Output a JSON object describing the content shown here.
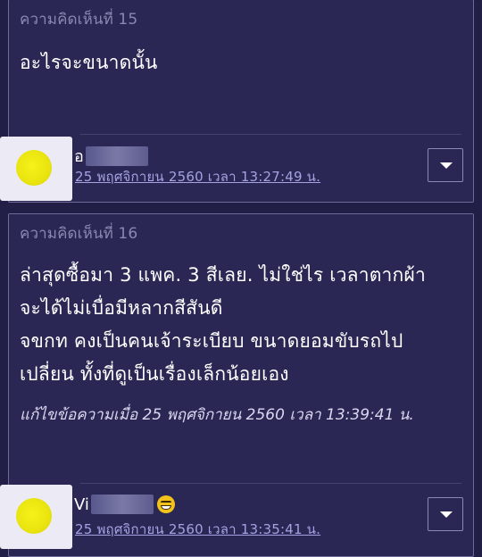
{
  "comments": [
    {
      "header": "ความคิดเห็นที่ 15",
      "body_lines": [
        "อะไรจะขนาดนั้น"
      ],
      "edited_note": "",
      "username_visible": "อ",
      "timestamp": "25 พฤศจิกายน 2560 เวลา 13:27:49 น.",
      "has_emoji": false
    },
    {
      "header": "ความคิดเห็นที่ 16",
      "body_lines": [
        "ล่าสุดซื้อมา 3 แพค. 3 สีเลย. ไม่ใช่ไร เวลาตากผ้า",
        "จะได้ไม่เบื่อมีหลากสีสันดี",
        "จขกท คงเป็นคนเจ้าระเบียบ ขนาดยอมขับรถไป",
        "เปลี่ยน  ทั้งที่ดูเป็นเรื่องเล็กน้อยเอง"
      ],
      "edited_note": "แก้ไขข้อความเมื่อ 25 พฤศจิกายน 2560 เวลา 13:39:41 น.",
      "username_visible": "Vi",
      "timestamp": "25 พฤศจิกายน 2560 เวลา 13:35:41 น.",
      "has_emoji": true,
      "emoji": "grinning-smiley-icon"
    }
  ],
  "colors": {
    "page_bg": "#221f46",
    "card_bg": "#2a2755",
    "card_border": "#6e6b98",
    "header_text": "#8a87b0",
    "link": "#a4a2e0",
    "avatar": "#f8f21a"
  }
}
